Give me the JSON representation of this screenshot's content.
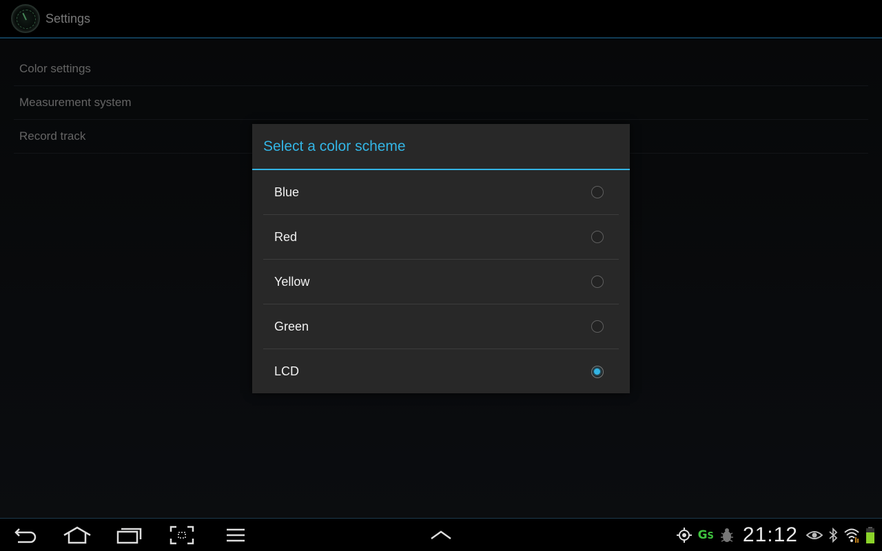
{
  "app": {
    "title": "Settings"
  },
  "preferences": [
    {
      "label": "Color settings"
    },
    {
      "label": "Measurement system"
    },
    {
      "label": "Record track"
    }
  ],
  "dialog": {
    "title": "Select a color scheme",
    "options": [
      {
        "label": "Blue",
        "checked": false
      },
      {
        "label": "Red",
        "checked": false
      },
      {
        "label": "Yellow",
        "checked": false
      },
      {
        "label": "Green",
        "checked": false
      },
      {
        "label": "LCD",
        "checked": true
      }
    ]
  },
  "statusbar": {
    "time": "21:12",
    "icons": [
      "gps-icon",
      "gs-app-icon",
      "bug-icon",
      "eye-icon",
      "bluetooth-icon",
      "wifi-icon",
      "battery-icon"
    ]
  },
  "colors": {
    "accent": "#33b5e5",
    "dialog_bg": "#282828",
    "app_status_green": "#3ec23e",
    "battery_green": "#8bd32a"
  }
}
